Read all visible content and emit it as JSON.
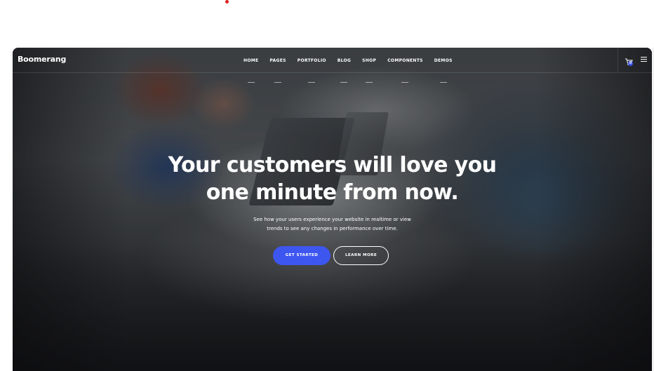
{
  "brand": {
    "name": "Boomerang"
  },
  "nav": {
    "items": [
      {
        "label": "HOME"
      },
      {
        "label": "PAGES"
      },
      {
        "label": "PORTFOLIO"
      },
      {
        "label": "BLOG"
      },
      {
        "label": "SHOP"
      },
      {
        "label": "COMPONENTS"
      },
      {
        "label": "DEMOS"
      }
    ]
  },
  "cart": {
    "icon": "cart-icon",
    "count": "0"
  },
  "menu": {
    "icon": "hamburger-menu-icon"
  },
  "hero": {
    "title_line1": "Your customers will love you",
    "title_line2": "one minute from now.",
    "subtitle_line1": "See how your users experience your website in realtime or view",
    "subtitle_line2": "trends to see any changes in performance over time.",
    "primary_button": "GET STARTED",
    "secondary_button": "LEARN MORE"
  },
  "colors": {
    "accent": "#3d56f0",
    "text": "#ffffff"
  }
}
